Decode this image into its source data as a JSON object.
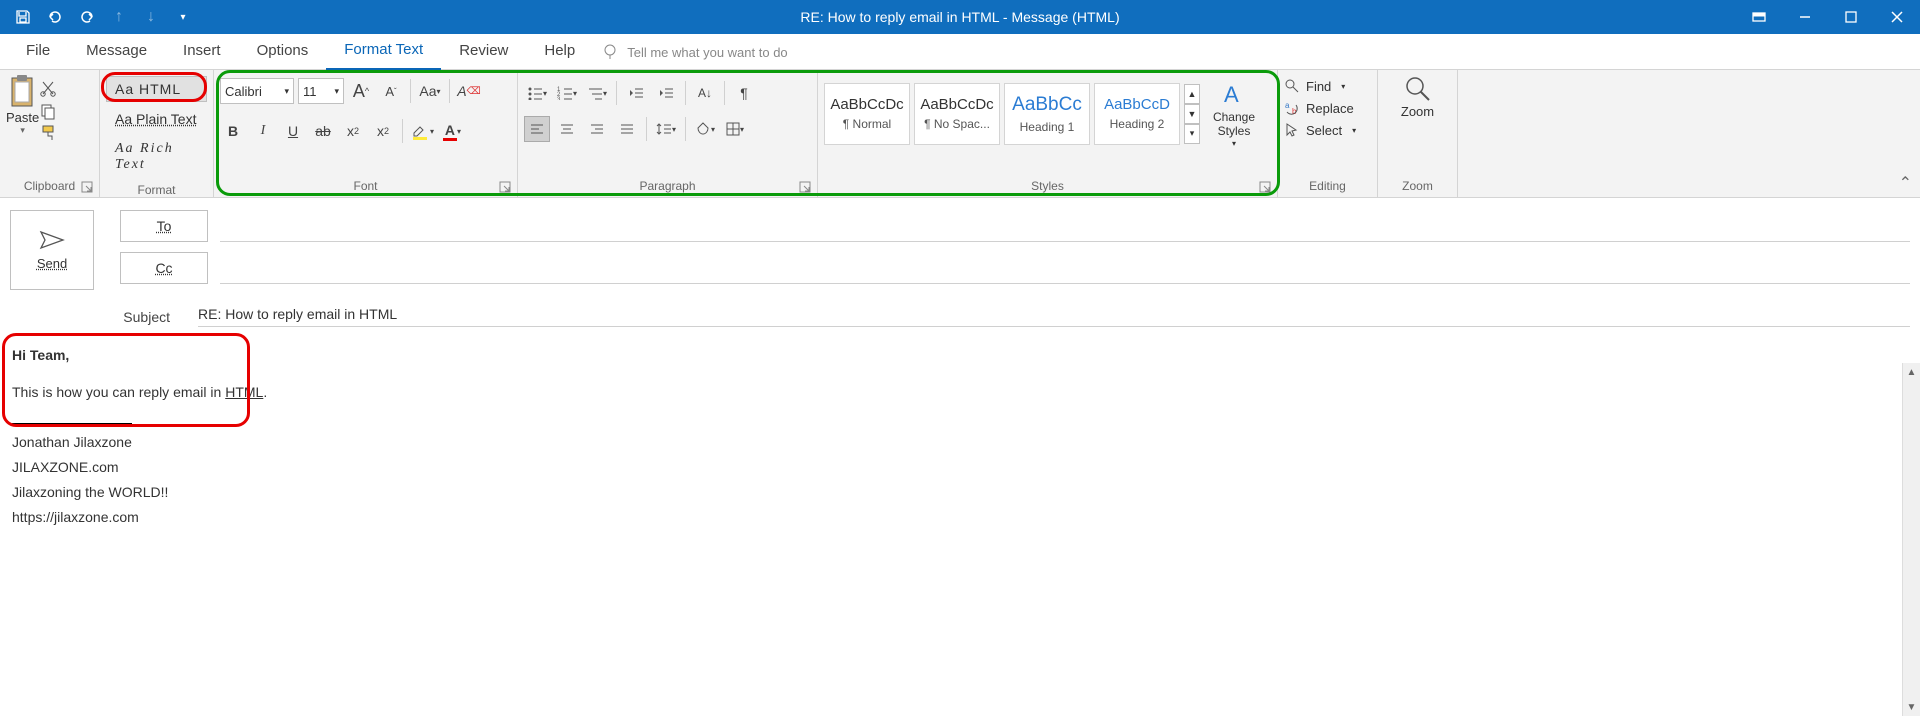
{
  "title": "RE: How to reply email in HTML  -  Message (HTML)",
  "menu": [
    "File",
    "Message",
    "Insert",
    "Options",
    "Format Text",
    "Review",
    "Help"
  ],
  "tellme": "Tell me what you want to do",
  "clipboard": {
    "paste": "Paste",
    "label": "Clipboard"
  },
  "format": {
    "html": "Aa HTML",
    "plain": "Aa Plain Text",
    "rich": "Aa Rich Text",
    "label": "Format"
  },
  "font": {
    "name": "Calibri",
    "size": "11",
    "label": "Font"
  },
  "paragraph": {
    "label": "Paragraph"
  },
  "styles": {
    "items": [
      {
        "sample": "AaBbCcDc",
        "name": "¶ Normal",
        "blue": false
      },
      {
        "sample": "AaBbCcDc",
        "name": "¶ No Spac...",
        "blue": false
      },
      {
        "sample": "AaBbCc",
        "name": "Heading 1",
        "blue": true
      },
      {
        "sample": "AaBbCcD",
        "name": "Heading 2",
        "blue": true
      }
    ],
    "change": "Change Styles",
    "label": "Styles"
  },
  "editing": {
    "find": "Find",
    "replace": "Replace",
    "select": "Select",
    "label": "Editing"
  },
  "zoom": {
    "btn": "Zoom",
    "label": "Zoom"
  },
  "compose": {
    "send": "Send",
    "to": "To",
    "cc": "Cc",
    "subject_label": "Subject",
    "subject": "RE: How to reply email in HTML"
  },
  "body": {
    "greeting": "Hi Team,",
    "line1a": "This is how you can reply email in ",
    "line1b": "HTML",
    "line1c": ".",
    "sig1": "Jonathan Jilaxzone",
    "sig2": "JILAXZONE.com",
    "sig3": "Jilaxzoning the WORLD!!",
    "sig4": "https://jilaxzone.com"
  }
}
